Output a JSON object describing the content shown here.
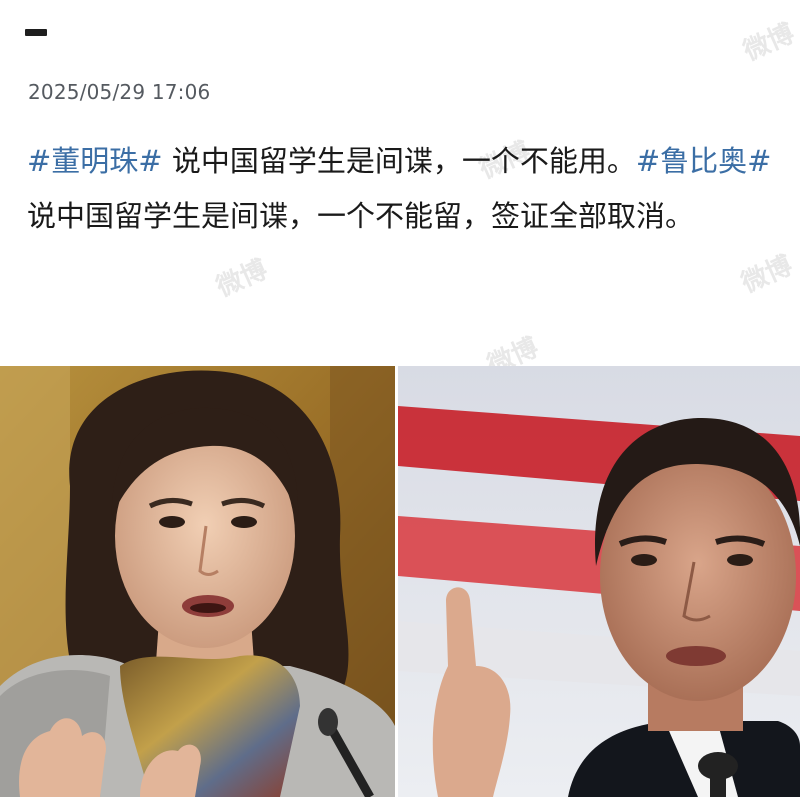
{
  "header": {
    "back_icon": "minus-dash-icon"
  },
  "post": {
    "timestamp": "2025/05/29 17:06",
    "segments": [
      {
        "text": "#董明珠#",
        "type": "hashtag"
      },
      {
        "text": " 说中国留学生是间谍，一个不能用。",
        "type": "text"
      },
      {
        "text": "#鲁比奥#",
        "type": "hashtag"
      },
      {
        "text": " 说中国留学生是间谍，一个不能留，签证全部取消。",
        "type": "text"
      }
    ]
  },
  "watermark": {
    "text": "微博"
  },
  "photos": [
    {
      "name": "left-photo",
      "subject": "woman-speaking"
    },
    {
      "name": "right-photo",
      "subject": "man-pointing"
    }
  ],
  "colors": {
    "hashtag": "#3b6ea5",
    "text": "#1a1a1a",
    "timestamp": "#555a60"
  }
}
